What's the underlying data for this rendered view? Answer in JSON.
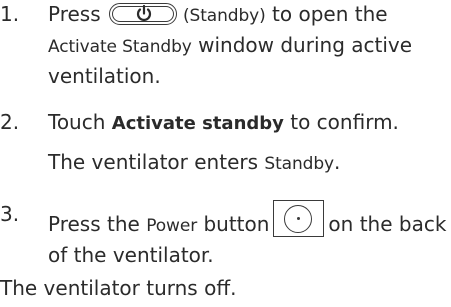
{
  "steps": [
    {
      "number": "1.",
      "pre": "Press",
      "icon_name": "standby-icon",
      "paren": "(Standby)",
      "mid": "to open the",
      "window_name": "Activate Standby",
      "post": "window during active ventilation."
    },
    {
      "number": "2.",
      "pre": "Touch",
      "bold": "Activate standby",
      "post": "to confirm.",
      "result_pre": "The ventilator enters",
      "result_term": "Standby",
      "result_post": "."
    },
    {
      "number": "3.",
      "pre": "Press the",
      "term": "Power",
      "mid": "button",
      "icon_name": "power-button-icon",
      "post": "on the back of the ventilator."
    }
  ],
  "final": "The ventilator turns off."
}
